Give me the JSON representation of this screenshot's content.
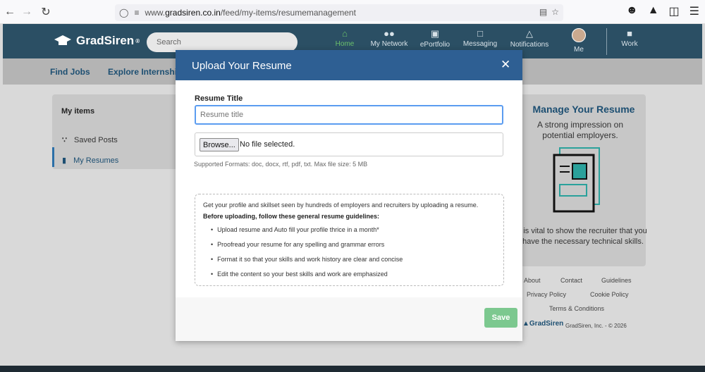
{
  "browser": {
    "url_prefix": "www.",
    "url_host": "gradsiren.co.in",
    "url_path": "/feed/my-items/resumemanagement"
  },
  "header": {
    "brand": "GradSiren",
    "brand_mark": "®",
    "search_placeholder": "Search",
    "nav": [
      {
        "label": "Home",
        "icon": "home-icon"
      },
      {
        "label": "My Network",
        "icon": "people-icon"
      },
      {
        "label": "ePortfolio",
        "icon": "portfolio-icon"
      },
      {
        "label": "Messaging",
        "icon": "message-icon"
      },
      {
        "label": "Notifications",
        "icon": "bell-icon"
      },
      {
        "label": "Me",
        "icon": "avatar"
      },
      {
        "label": "Work",
        "icon": "work-icon"
      }
    ]
  },
  "subnav": {
    "find_jobs": "Find Jobs",
    "explore_internships": "Explore Internship"
  },
  "left_panel": {
    "title": "My items",
    "items": [
      {
        "label": "Saved Posts",
        "icon": "rss-icon"
      },
      {
        "label": "My Resumes",
        "icon": "document-icon"
      }
    ]
  },
  "right_panel": {
    "title": "Manage Your Resume",
    "subtitle": "A strong impression on potential employers.",
    "body": "t is vital to show the recruiter that you have the necessary technical skills."
  },
  "footer": {
    "about": "About",
    "contact": "Contact",
    "guidelines": "Guidelines",
    "privacy": "Privacy Policy",
    "cookie": "Cookie Policy",
    "terms": "Terms & Conditions",
    "logo": "GradSiren",
    "copyright": "GradSiren, Inc. - © 2026"
  },
  "modal": {
    "title": "Upload Your Resume",
    "close": "✕",
    "field_label": "Resume Title",
    "field_placeholder": "Resume title",
    "browse_label": "Browse...",
    "file_status": "No file selected.",
    "formats": "Supported Formats: doc, docx, rtf, pdf, txt. Max file size: 5 MB",
    "guide_intro": "Get your profile and skillset seen by hundreds of employers and recruiters by uploading a resume.",
    "guide_head": "Before uploading, follow these general resume guidelines:",
    "guidelines": [
      "Upload resume and Auto fill your profile thrice in a month*",
      "Proofread your resume for any spelling and grammar errors",
      "Format it so that your skills and work history are clear and concise",
      "Edit the content so your best skills and work are emphasized"
    ],
    "save_label": "Save"
  },
  "colors": {
    "header_bg": "#2b4f64",
    "modal_header": "#2e5f93",
    "save_bg": "#7cc88f",
    "brand_blue": "#1d4f72",
    "active_green": "#6bc06b"
  }
}
